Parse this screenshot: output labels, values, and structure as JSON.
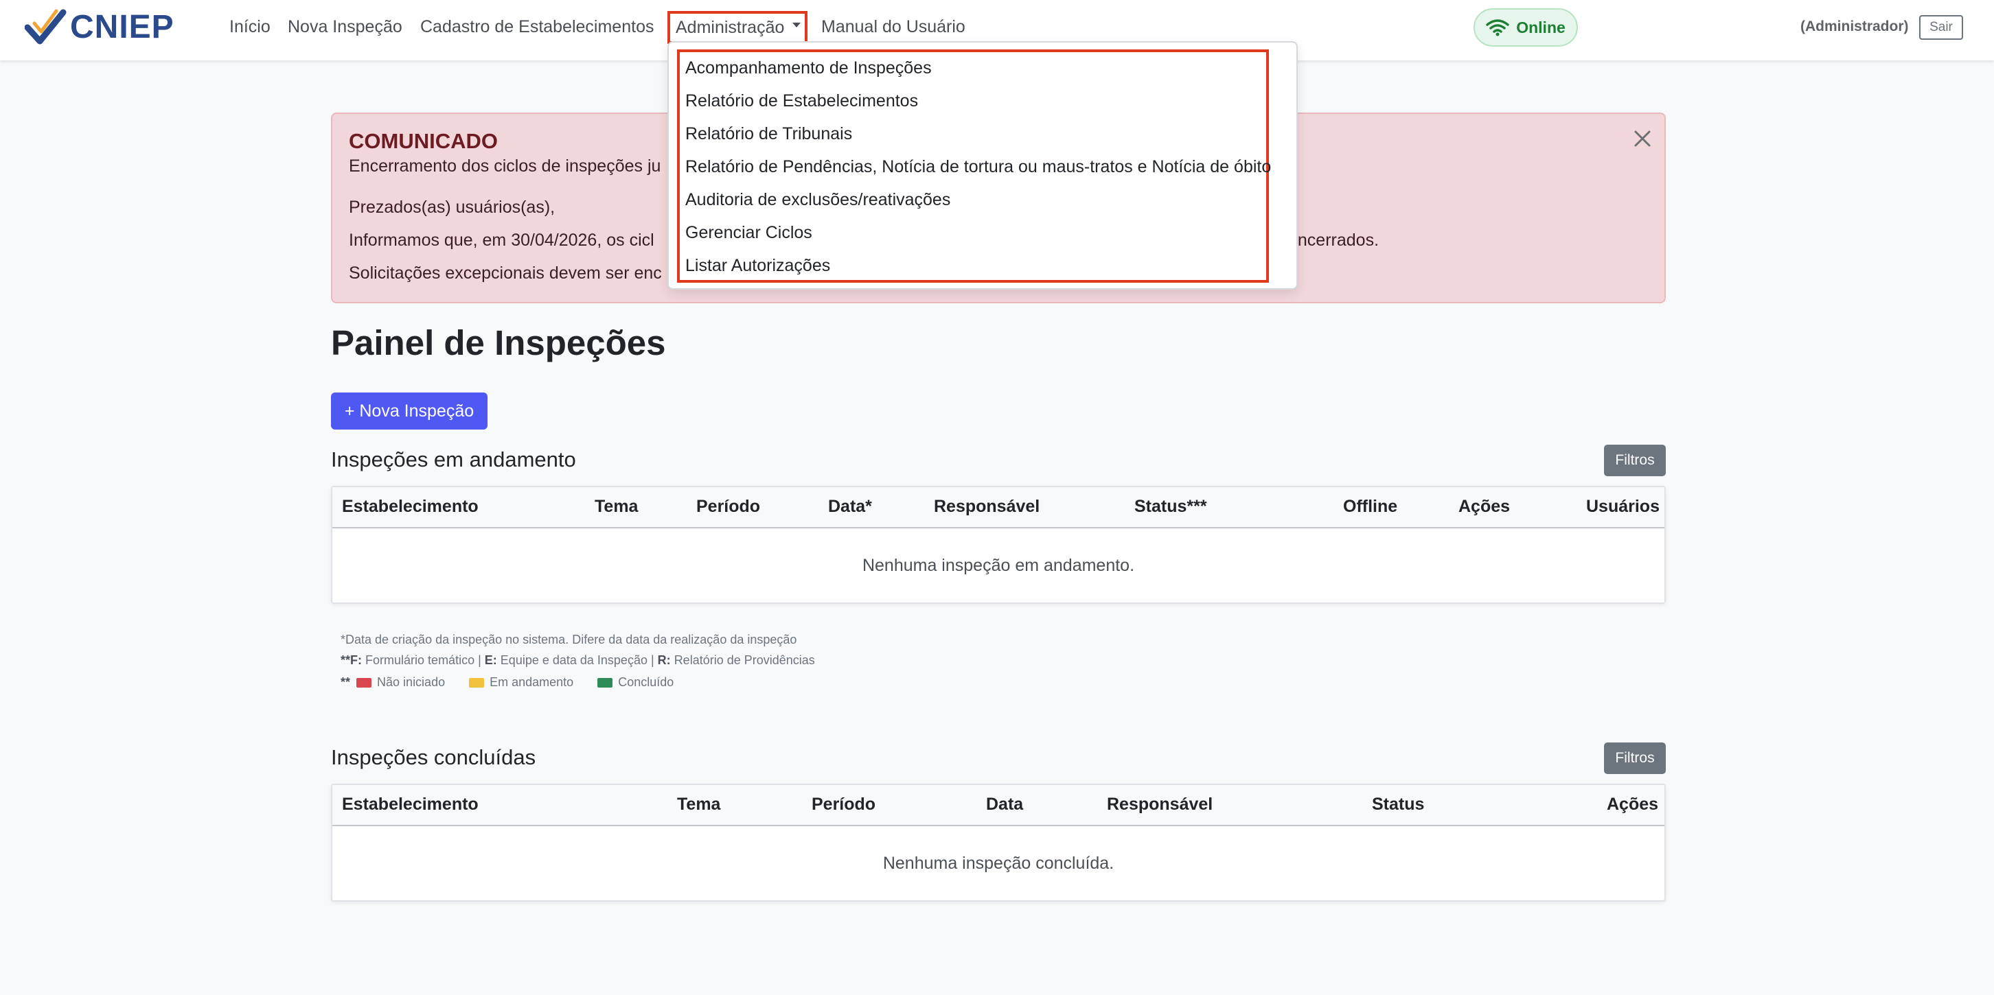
{
  "navbar": {
    "brand": "CNIEP",
    "links": [
      "Início",
      "Nova Inspeção",
      "Cadastro de Estabelecimentos"
    ],
    "admin_label": "Administração",
    "manual_label": "Manual do Usuário",
    "status": "Online",
    "user_role": "(Administrador)",
    "logout_label": "Sair"
  },
  "dropdown": {
    "items": [
      "Acompanhamento de Inspeções",
      "Relatório de Estabelecimentos",
      "Relatório de Tribunais",
      "Relatório de Pendências, Notícia de tortura ou maus-tratos e Notícia de óbito",
      "Auditoria de exclusões/reativações",
      "Gerenciar Ciclos",
      "Listar Autorizações"
    ]
  },
  "alert": {
    "title": "COMUNICADO",
    "subtitle": "Encerramento dos ciclos de inspeções ju",
    "greeting": "Prezados(as) usuários(as),",
    "line1_start": "Informamos que, em 30/04/2026, os cicl",
    "line1_end": "encerrados.",
    "line2_start": "Solicitações excepcionais devem ser enc"
  },
  "main": {
    "title": "Painel de Inspeções",
    "new_button": "+ Nova Inspeção",
    "ongoing": {
      "title": "Inspeções em andamento",
      "filter_label": "Filtros",
      "columns": [
        "Estabelecimento",
        "Tema",
        "Período",
        "Data*",
        "Responsável",
        "Status***",
        "Offline",
        "Ações",
        "Usuários"
      ],
      "empty": "Nenhuma inspeção em andamento."
    },
    "footnotes": {
      "note1": "*Data de criação da inspeção no sistema. Difere da data da realização da inspeção",
      "note2_prefix": "**",
      "note2_f": "F:",
      "note2_f_text": "Formulário temático |",
      "note2_e": "E:",
      "note2_e_text": "Equipe e data da Inspeção |",
      "note2_r": "R:",
      "note2_r_text": "Relatório de Providências",
      "legend_prefix": "**",
      "legend": [
        {
          "label": "Não iniciado",
          "color": "#d9454f"
        },
        {
          "label": "Em andamento",
          "color": "#f3c23c"
        },
        {
          "label": "Concluído",
          "color": "#2e8b57"
        }
      ]
    },
    "completed": {
      "title": "Inspeções concluídas",
      "filter_label": "Filtros",
      "columns": [
        "Estabelecimento",
        "Tema",
        "Período",
        "Data",
        "Responsável",
        "Status",
        "Ações"
      ],
      "empty": "Nenhuma inspeção concluída."
    }
  },
  "colors": {
    "primary": "#5058f4",
    "highlight": "#e03a1e",
    "online_green": "#1e7e34",
    "alert_bg": "#f2d7da"
  }
}
